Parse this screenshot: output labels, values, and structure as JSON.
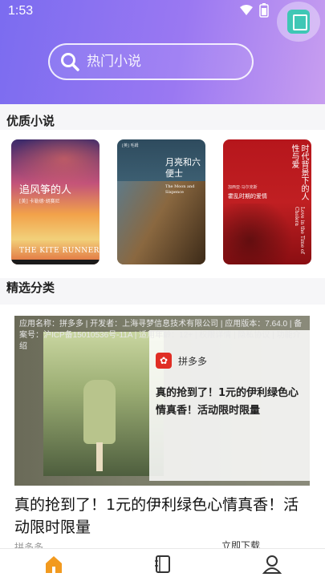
{
  "status": {
    "time": "1:53"
  },
  "search": {
    "placeholder": "热门小说"
  },
  "sections": {
    "featured_title": "优质小说",
    "category_title": "精选分类"
  },
  "books": [
    {
      "title": "追风筝的人",
      "author": "[美] 卡勒德·胡赛尼",
      "subtitle": "THE KITE RUNNER"
    },
    {
      "title": "月亮和六便士",
      "author": "[英] 毛姆",
      "subtitle": "The Moon and Sixpence"
    },
    {
      "title": "霍乱时期的爱情",
      "author": "加西亚·马尔克斯",
      "subtitle": "Love in the Time of Cholera",
      "tagline": "时代背景下的人性与爱"
    }
  ],
  "ad": {
    "meta": "应用名称：拼多多 | 开发者：上海寻梦信息技术有限公司 | 应用版本：7.64.0 | 备案号：沪ICP备15010536号-11A | 适用年龄：12+ | 权限详情 | 隐私协议 | 功能介绍",
    "brand": "拼多多",
    "slogan": "真的抢到了！1元的伊利绿色心情真香！活动限时限量",
    "headline": "真的抢到了！1元的伊利绿色心情真香！活动限时限量",
    "foot_brand": "拼多多",
    "download_label": "立即下载"
  },
  "nav": {
    "home": "home-icon",
    "shelf": "bookshelf-icon",
    "me": "profile-icon"
  },
  "colors": {
    "header_start": "#7b6cf0",
    "header_end": "#c89ef0",
    "accent": "#f29a1f"
  }
}
